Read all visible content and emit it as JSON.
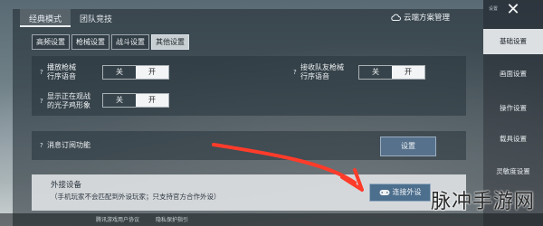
{
  "top_tabs": [
    "经典模式",
    "团队竞技"
  ],
  "cloud_label": "云端方案管理",
  "subtabs": [
    "高频设置",
    "枪械设置",
    "战斗设置",
    "其他设置"
  ],
  "settings": {
    "gun_voice": {
      "label": [
        "播放枪械",
        "行序语音"
      ],
      "off": "关",
      "on": "开"
    },
    "team_voice": {
      "label": [
        "接收队友枪械",
        "行序语音"
      ],
      "off": "关",
      "on": "开"
    },
    "light_image": {
      "label": [
        "显示正在观战",
        "的光子鸡形象"
      ],
      "off": "关",
      "on": "开"
    },
    "subscribe": {
      "label": "消息订阅功能",
      "button": "设置"
    },
    "peripheral": {
      "title": "外接设备",
      "desc": "（手机玩家不会匹配到外设玩家；只支持官方合作外设）",
      "button": "连接外设"
    }
  },
  "sidebar": {
    "items": [
      "基础设置",
      "画面设置",
      "操作设置",
      "载具设置",
      "灵敏度设置"
    ],
    "active": 0,
    "corner_text": "设置"
  },
  "bottom_bar": [
    "腾讯游戏用户协议",
    "隐私保护指引"
  ],
  "watermark": "脉冲手游网",
  "help_marks": [
    "?",
    "?",
    "?",
    "?"
  ],
  "colors": {
    "annotation_arrow": "#ff3b2a",
    "active_tab": "#eef1f3"
  }
}
